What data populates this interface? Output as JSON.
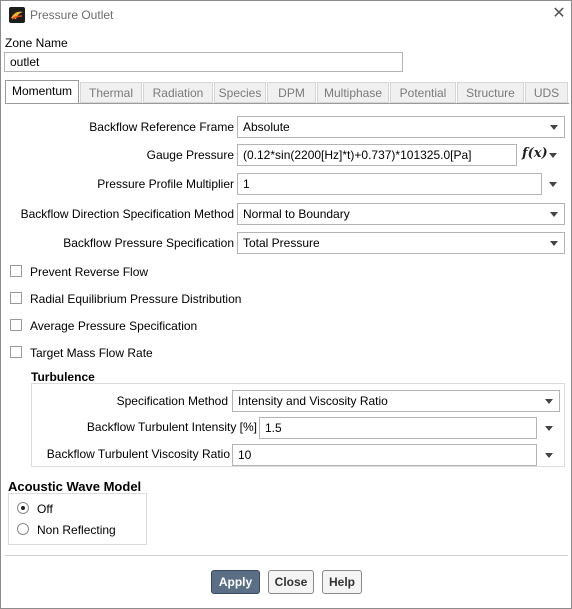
{
  "window": {
    "title": "Pressure Outlet"
  },
  "zone": {
    "label": "Zone Name",
    "value": "outlet"
  },
  "tabs": [
    "Momentum",
    "Thermal",
    "Radiation",
    "Species",
    "DPM",
    "Multiphase",
    "Potential",
    "Structure",
    "UDS"
  ],
  "momentum": {
    "backflow_ref_frame": {
      "label": "Backflow Reference Frame",
      "value": "Absolute"
    },
    "gauge_pressure": {
      "label": "Gauge Pressure",
      "value": "(0.12*sin(2200[Hz]*t)+0.737)*101325.0[Pa]",
      "fx_icon": "f(x)"
    },
    "profile_multiplier": {
      "label": "Pressure Profile Multiplier",
      "value": "1"
    },
    "backflow_dir_method": {
      "label": "Backflow Direction Specification Method",
      "value": "Normal to Boundary"
    },
    "backflow_pressure_spec": {
      "label": "Backflow Pressure Specification",
      "value": "Total Pressure"
    },
    "checkboxes": [
      "Prevent Reverse Flow",
      "Radial Equilibrium Pressure Distribution",
      "Average Pressure Specification",
      "Target Mass Flow Rate"
    ]
  },
  "turbulence": {
    "heading": "Turbulence",
    "spec_method": {
      "label": "Specification Method",
      "value": "Intensity and Viscosity Ratio"
    },
    "intensity": {
      "label": "Backflow Turbulent Intensity [%]",
      "value": "1.5"
    },
    "viscosity_ratio": {
      "label": "Backflow Turbulent Viscosity Ratio",
      "value": "10"
    }
  },
  "acoustic": {
    "heading": "Acoustic Wave Model",
    "options": [
      "Off",
      "Non Reflecting"
    ],
    "selected": "Off"
  },
  "buttons": {
    "apply": "Apply",
    "close": "Close",
    "help": "Help"
  }
}
